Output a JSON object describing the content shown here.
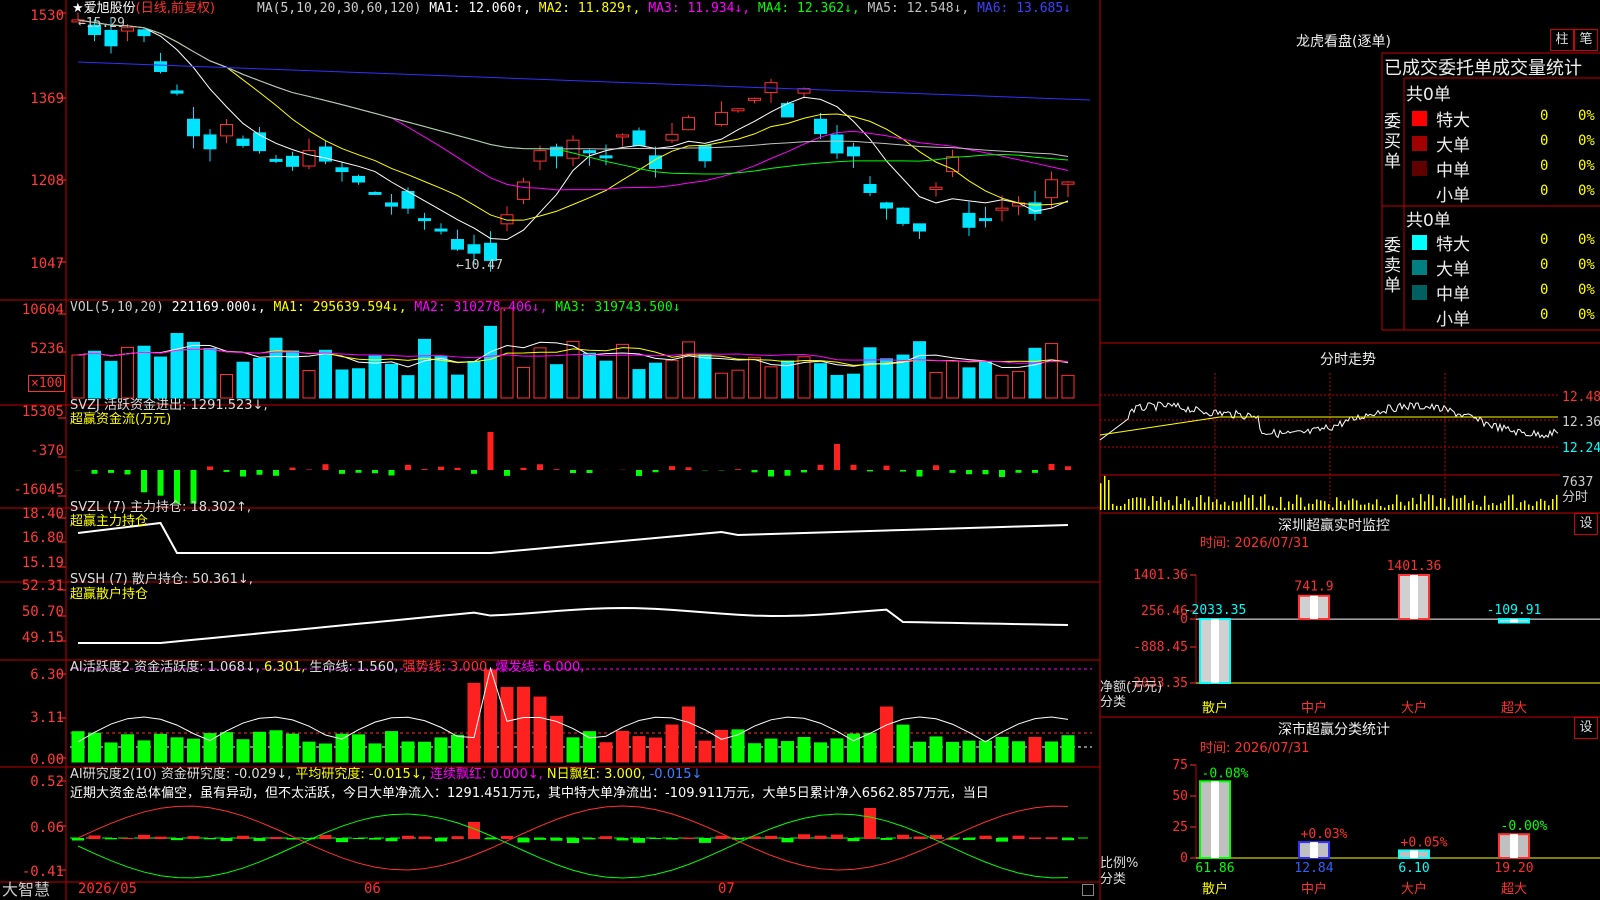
{
  "stock": {
    "name": "爱旭股份",
    "mode": "(日线,前复权)",
    "star": "★"
  },
  "ma_header": [
    {
      "text": "MA(5,10,20,30,60,120)",
      "color": "#cccccc"
    },
    {
      "text": "MA1: 12.060↑,",
      "color": "#ffffff"
    },
    {
      "text": "MA2: 11.829↑,",
      "color": "#ffff00"
    },
    {
      "text": "MA3: 11.934↓,",
      "color": "#ff00ff"
    },
    {
      "text": "MA4: 12.362↓,",
      "color": "#00ff00"
    },
    {
      "text": "MA5: 12.548↓,",
      "color": "#c0c0c0"
    },
    {
      "text": "MA6: 13.685↓",
      "color": "#4040ff"
    }
  ],
  "price_panel": {
    "y_ticks": [
      "1530",
      "1369",
      "1208",
      "1047"
    ],
    "high_label": "←15.29",
    "low_label": "←10.47"
  },
  "vol_panel": {
    "header": [
      {
        "text": "VOL(5,10,20)",
        "color": "#cccccc"
      },
      {
        "text": "221169.000↓,",
        "color": "#ffffff"
      },
      {
        "text": "MA1: 295639.594↓,",
        "color": "#ffff00"
      },
      {
        "text": "MA2: 310278.406↓,",
        "color": "#ff00ff"
      },
      {
        "text": "MA3: 319743.500↓",
        "color": "#00ff00"
      }
    ],
    "y_ticks": [
      "10604",
      "5236"
    ],
    "unit": "×100"
  },
  "svzj_panel": {
    "header": "SVZJ  活跃资金进出: 1291.523↓,",
    "sub": "超赢资金流(万元)",
    "y_ticks": [
      "15305",
      "-370",
      "-16045"
    ]
  },
  "svzl_panel": {
    "header": "SVZL (7) 主力持仓: 18.302↑,",
    "sub": "超赢主力持仓",
    "y_ticks": [
      "18.40",
      "16.80",
      "15.19"
    ]
  },
  "svsh_panel": {
    "header": "SVSH (7) 散户持仓: 50.361↓,",
    "sub": "超赢散户持仓",
    "y_ticks": [
      "52.31",
      "50.70",
      "49.15"
    ]
  },
  "ai_active_panel": {
    "header": [
      {
        "text": "AI活跃度2 资金活跃度: 1.068↓,",
        "color": "#dddddd"
      },
      {
        "text": "6.301,",
        "color": "#ffff00"
      },
      {
        "text": "生命线: 1.560,",
        "color": "#dddddd"
      },
      {
        "text": "强势线: 3.000,",
        "color": "#ff3030"
      },
      {
        "text": "爆发线: 6.000,",
        "color": "#ff00ff"
      }
    ],
    "y_ticks": [
      "6.30",
      "3.11",
      "0.00"
    ]
  },
  "ai_research_panel": {
    "header": [
      {
        "text": "AI研究度2(10) 资金研究度: -0.029↓,",
        "color": "#dddddd"
      },
      {
        "text": "平均研究度: -0.015↓,",
        "color": "#ffff00"
      },
      {
        "text": "连续飘红: 0.000↓,",
        "color": "#ff00ff"
      },
      {
        "text": "N日飘红: 3.000,",
        "color": "#ffff00"
      },
      {
        "text": "-0.015↓",
        "color": "#4080ff"
      }
    ],
    "commentary": "近期大资金总体偏空，虽有异动，但不太活跃，今日大单净流入：1291.451万元，其中特大单净流出：-109.911万元，大单5日累计净入6562.857万元，当日",
    "y_ticks": [
      "0.52",
      "0.06",
      "-0.41"
    ]
  },
  "footer": {
    "brand": "大智慧",
    "dates": [
      "2026/05",
      "06",
      "07"
    ]
  },
  "lhb": {
    "title": "龙虎看盘(逐单)",
    "tabs": [
      "柱",
      "笔"
    ],
    "subtitle": "已成交委托单成交量统计",
    "buy": {
      "side_label": "委买单",
      "total": "共0单",
      "rows": [
        {
          "label": "特大",
          "color": "#ff0000",
          "v1": "0",
          "v2": "0%"
        },
        {
          "label": "大单",
          "color": "#a00000",
          "v1": "0",
          "v2": "0%"
        },
        {
          "label": "中单",
          "color": "#600000",
          "v1": "0",
          "v2": "0%"
        },
        {
          "label": "小单",
          "color": "#000000",
          "v1": "0",
          "v2": "0%"
        }
      ]
    },
    "sell": {
      "side_label": "委卖单",
      "total": "共0单",
      "rows": [
        {
          "label": "特大",
          "color": "#00ffff",
          "v1": "0",
          "v2": "0%"
        },
        {
          "label": "大单",
          "color": "#008080",
          "v1": "0",
          "v2": "0%"
        },
        {
          "label": "中单",
          "color": "#006060",
          "v1": "0",
          "v2": "0%"
        },
        {
          "label": "小单",
          "color": "#000000",
          "v1": "0",
          "v2": "0%"
        }
      ]
    }
  },
  "intraday": {
    "title": "分时走势",
    "prices": [
      "12.48",
      "12.36",
      "12.24"
    ],
    "vol_label": "7637",
    "vol_unit": "分时"
  },
  "monitor": {
    "title": "深圳超赢实时监控",
    "setting": "设",
    "time": "时间: 2026/07/31",
    "y_ticks": [
      "1401.36",
      "256.46",
      "0",
      "-888.45",
      "-2033.35"
    ],
    "ylabel": "净额(万元)",
    "xlabel": "分类",
    "categories": [
      "散户",
      "中户",
      "大户",
      "超大"
    ],
    "value_labels": [
      "-2033.35",
      "741.9",
      "1401.36",
      "-109.91"
    ]
  },
  "classify": {
    "title": "深市超赢分类统计",
    "setting": "设",
    "time": "时间: 2026/07/31",
    "y_ticks": [
      "75",
      "50",
      "25",
      "0"
    ],
    "ylabel": "比例%",
    "xlabel": "分类",
    "categories": [
      "散户",
      "中户",
      "大户",
      "超大"
    ],
    "change_labels": [
      "-0.08%",
      "+0.03%",
      "+0.05%",
      "-0.00%"
    ],
    "ratio_labels": [
      "61.86",
      "12.84",
      "6.10",
      "19.20"
    ]
  },
  "chart_data": [
    {
      "type": "bar",
      "title": "深圳超赢实时监控",
      "ylabel": "净额(万元)",
      "xlabel": "分类",
      "categories": [
        "散户",
        "中户",
        "大户",
        "超大"
      ],
      "values": [
        -2033.35,
        741.9,
        1401.36,
        -109.91
      ],
      "ylim": [
        -2033.35,
        1401.36
      ]
    },
    {
      "type": "bar",
      "title": "深市超赢分类统计",
      "ylabel": "比例%",
      "xlabel": "分类",
      "categories": [
        "散户",
        "中户",
        "大户",
        "超大"
      ],
      "values": [
        61.86,
        12.84,
        6.1,
        19.2
      ],
      "ylim": [
        0,
        75
      ]
    }
  ]
}
